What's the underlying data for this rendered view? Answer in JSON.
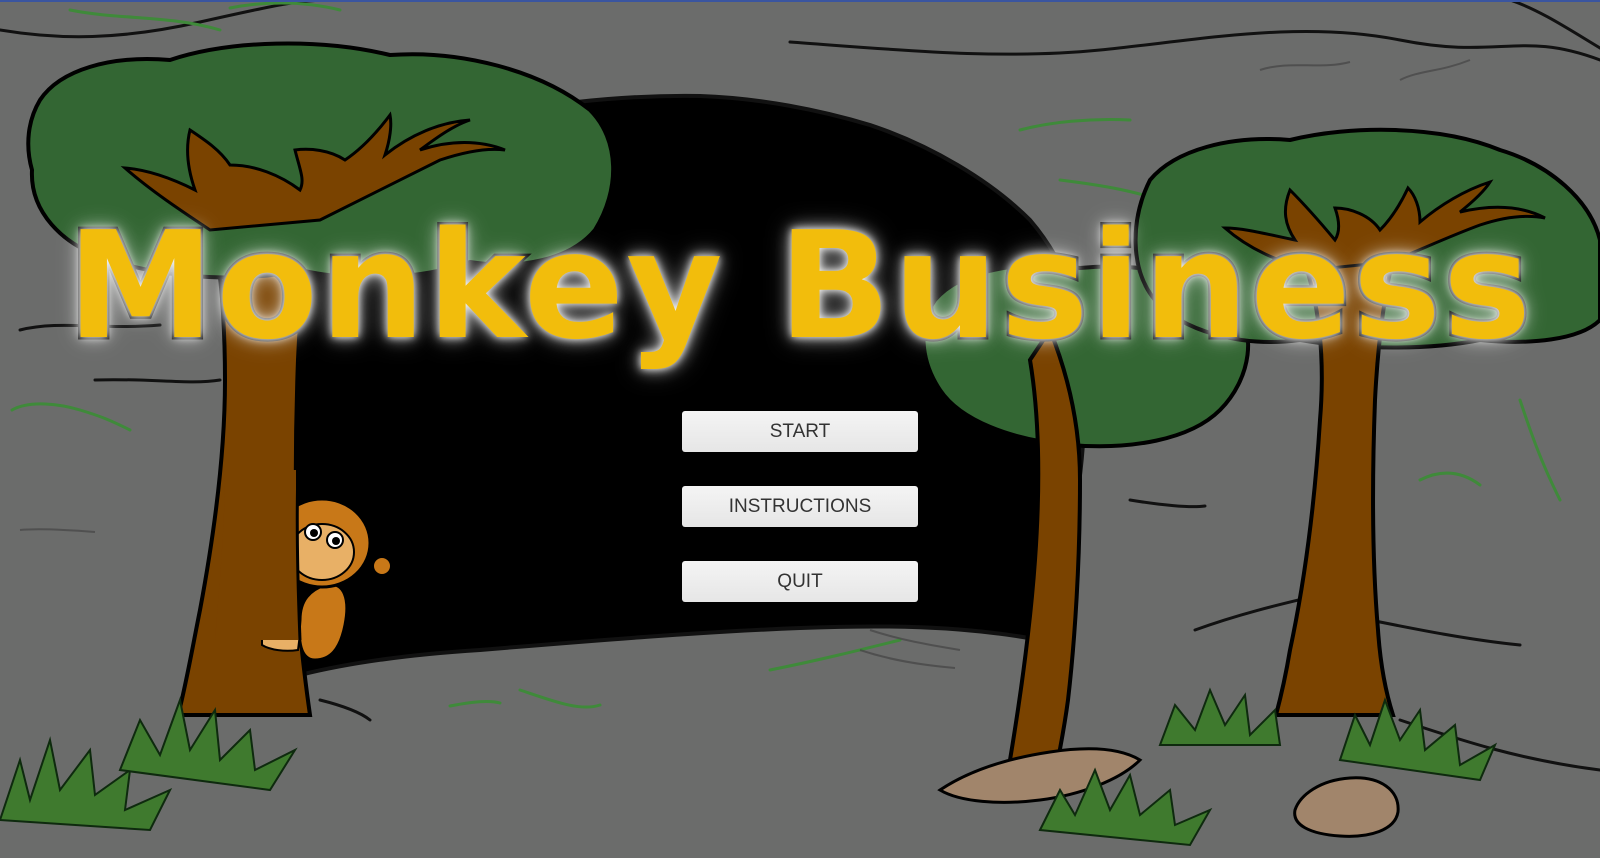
{
  "game": {
    "title": "Monkey Business"
  },
  "menu": {
    "start_label": "START",
    "instructions_label": "INSTRUCTIONS",
    "quit_label": "QUIT"
  },
  "colors": {
    "background_rock": "#6b6c6b",
    "cave_interior": "#000000",
    "foliage": "#336633",
    "trunk": "#7a4300",
    "title_fill": "#f2bd0c",
    "button_face": "#ededed",
    "button_text": "#333333"
  }
}
